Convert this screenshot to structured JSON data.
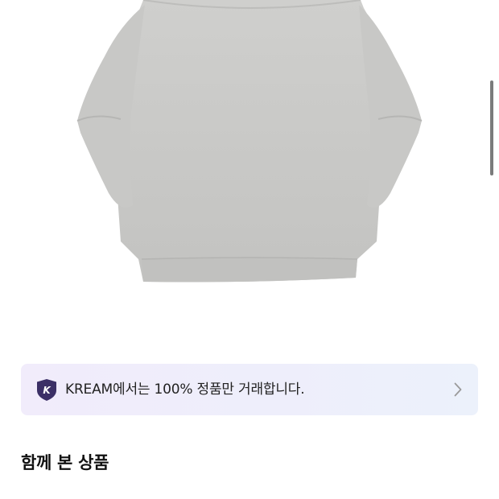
{
  "product": {
    "image_icon": "sweatshirt-image",
    "color": "#c9c9c7"
  },
  "banner": {
    "icon": "kream-shield-icon",
    "icon_letter": "K",
    "icon_color": "#3b2f66",
    "text": "KREAM에서는 100% 정품만 거래합니다.",
    "chevron": "chevron-right-icon"
  },
  "section": {
    "title": "함께 본 상품"
  }
}
